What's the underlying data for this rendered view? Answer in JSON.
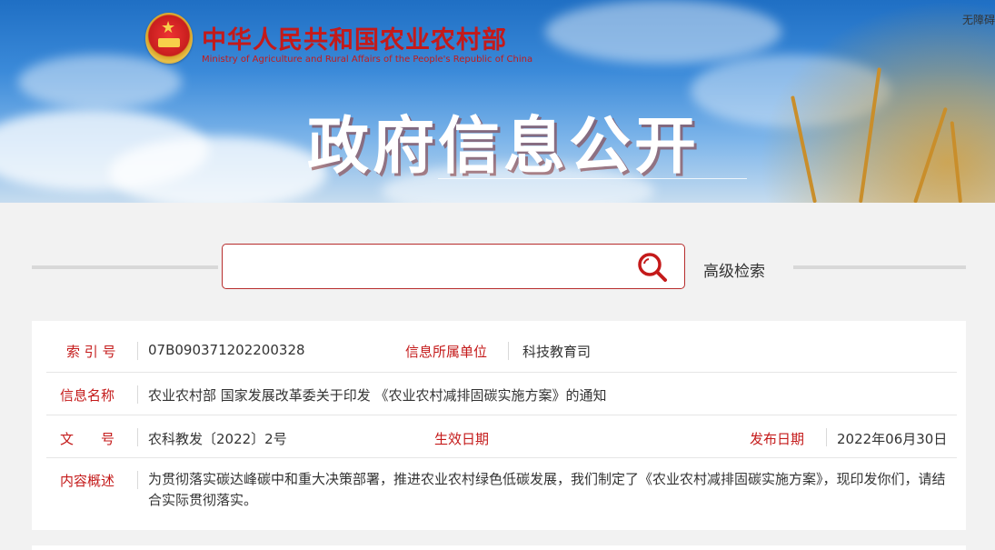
{
  "header": {
    "ministry_cn": "中华人民共和国农业农村部",
    "ministry_en": "Ministry of Agriculture and Rural Affairs of the People's Republic of China",
    "accessibility": "无障碍",
    "section_title": "政府信息公开"
  },
  "search": {
    "value": "",
    "placeholder": "",
    "advanced_label": "高级检索",
    "icon": "search-icon"
  },
  "info": {
    "index_label": "索 引 号",
    "index_value": "07B090371202200328",
    "unit_label": "信息所属单位",
    "unit_value": "科技教育司",
    "name_label": "信息名称",
    "name_value": "农业农村部 国家发展改革委关于印发 《农业农村减排固碳实施方案》的通知",
    "doc_label": "文　　号",
    "doc_value": "农科教发〔2022〕2号",
    "effective_label": "生效日期",
    "effective_value": "",
    "publish_label": "发布日期",
    "publish_value": "2022年06月30日",
    "summary_label": "内容概述",
    "summary_value": "为贯彻落实碳达峰碳中和重大决策部署，推进农业农村绿色低碳发展，我们制定了《农业农村减排固碳实施方案》，现印发你们，请结合实际贯彻落实。"
  },
  "colors": {
    "accent": "#c41a1a",
    "page_bg": "#f2f2f2"
  }
}
